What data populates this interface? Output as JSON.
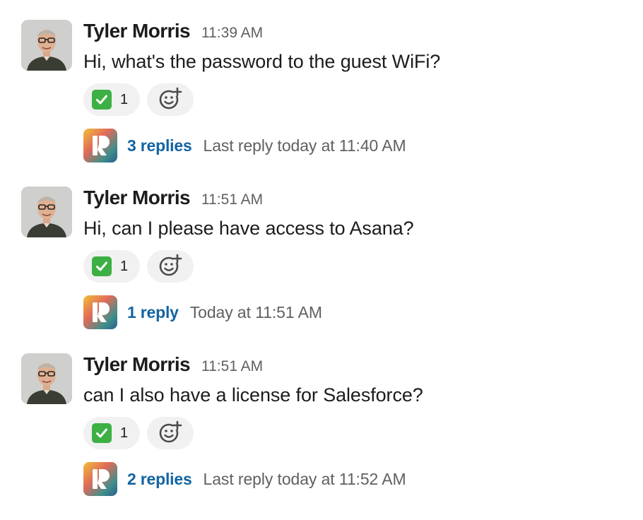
{
  "colors": {
    "author": "#1d1c1d",
    "timestamp": "#616061",
    "reply_link": "#1264a3",
    "reaction_bg": "#f1f1f1",
    "check_green": "#3cb043"
  },
  "messages": [
    {
      "author": "Tyler Morris",
      "time": "11:39 AM",
      "text": "Hi, what's the password to the guest WiFi?",
      "reaction": {
        "icon": "white-check-mark-emoji",
        "count": "1"
      },
      "add_reaction_icon": "add-reaction-icon",
      "thread": {
        "replies": "3 replies",
        "meta": "Last reply today at 11:40 AM"
      }
    },
    {
      "author": "Tyler Morris",
      "time": "11:51 AM",
      "text": "Hi, can I please have access to Asana?",
      "reaction": {
        "icon": "white-check-mark-emoji",
        "count": "1"
      },
      "add_reaction_icon": "add-reaction-icon",
      "thread": {
        "replies": "1 reply",
        "meta": "Today at 11:51 AM"
      }
    },
    {
      "author": "Tyler Morris",
      "time": "11:51 AM",
      "text": "can I also have a license for Salesforce?",
      "reaction": {
        "icon": "white-check-mark-emoji",
        "count": "1"
      },
      "add_reaction_icon": "add-reaction-icon",
      "thread": {
        "replies": "2 replies",
        "meta": "Last reply today at 11:52 AM"
      }
    }
  ]
}
